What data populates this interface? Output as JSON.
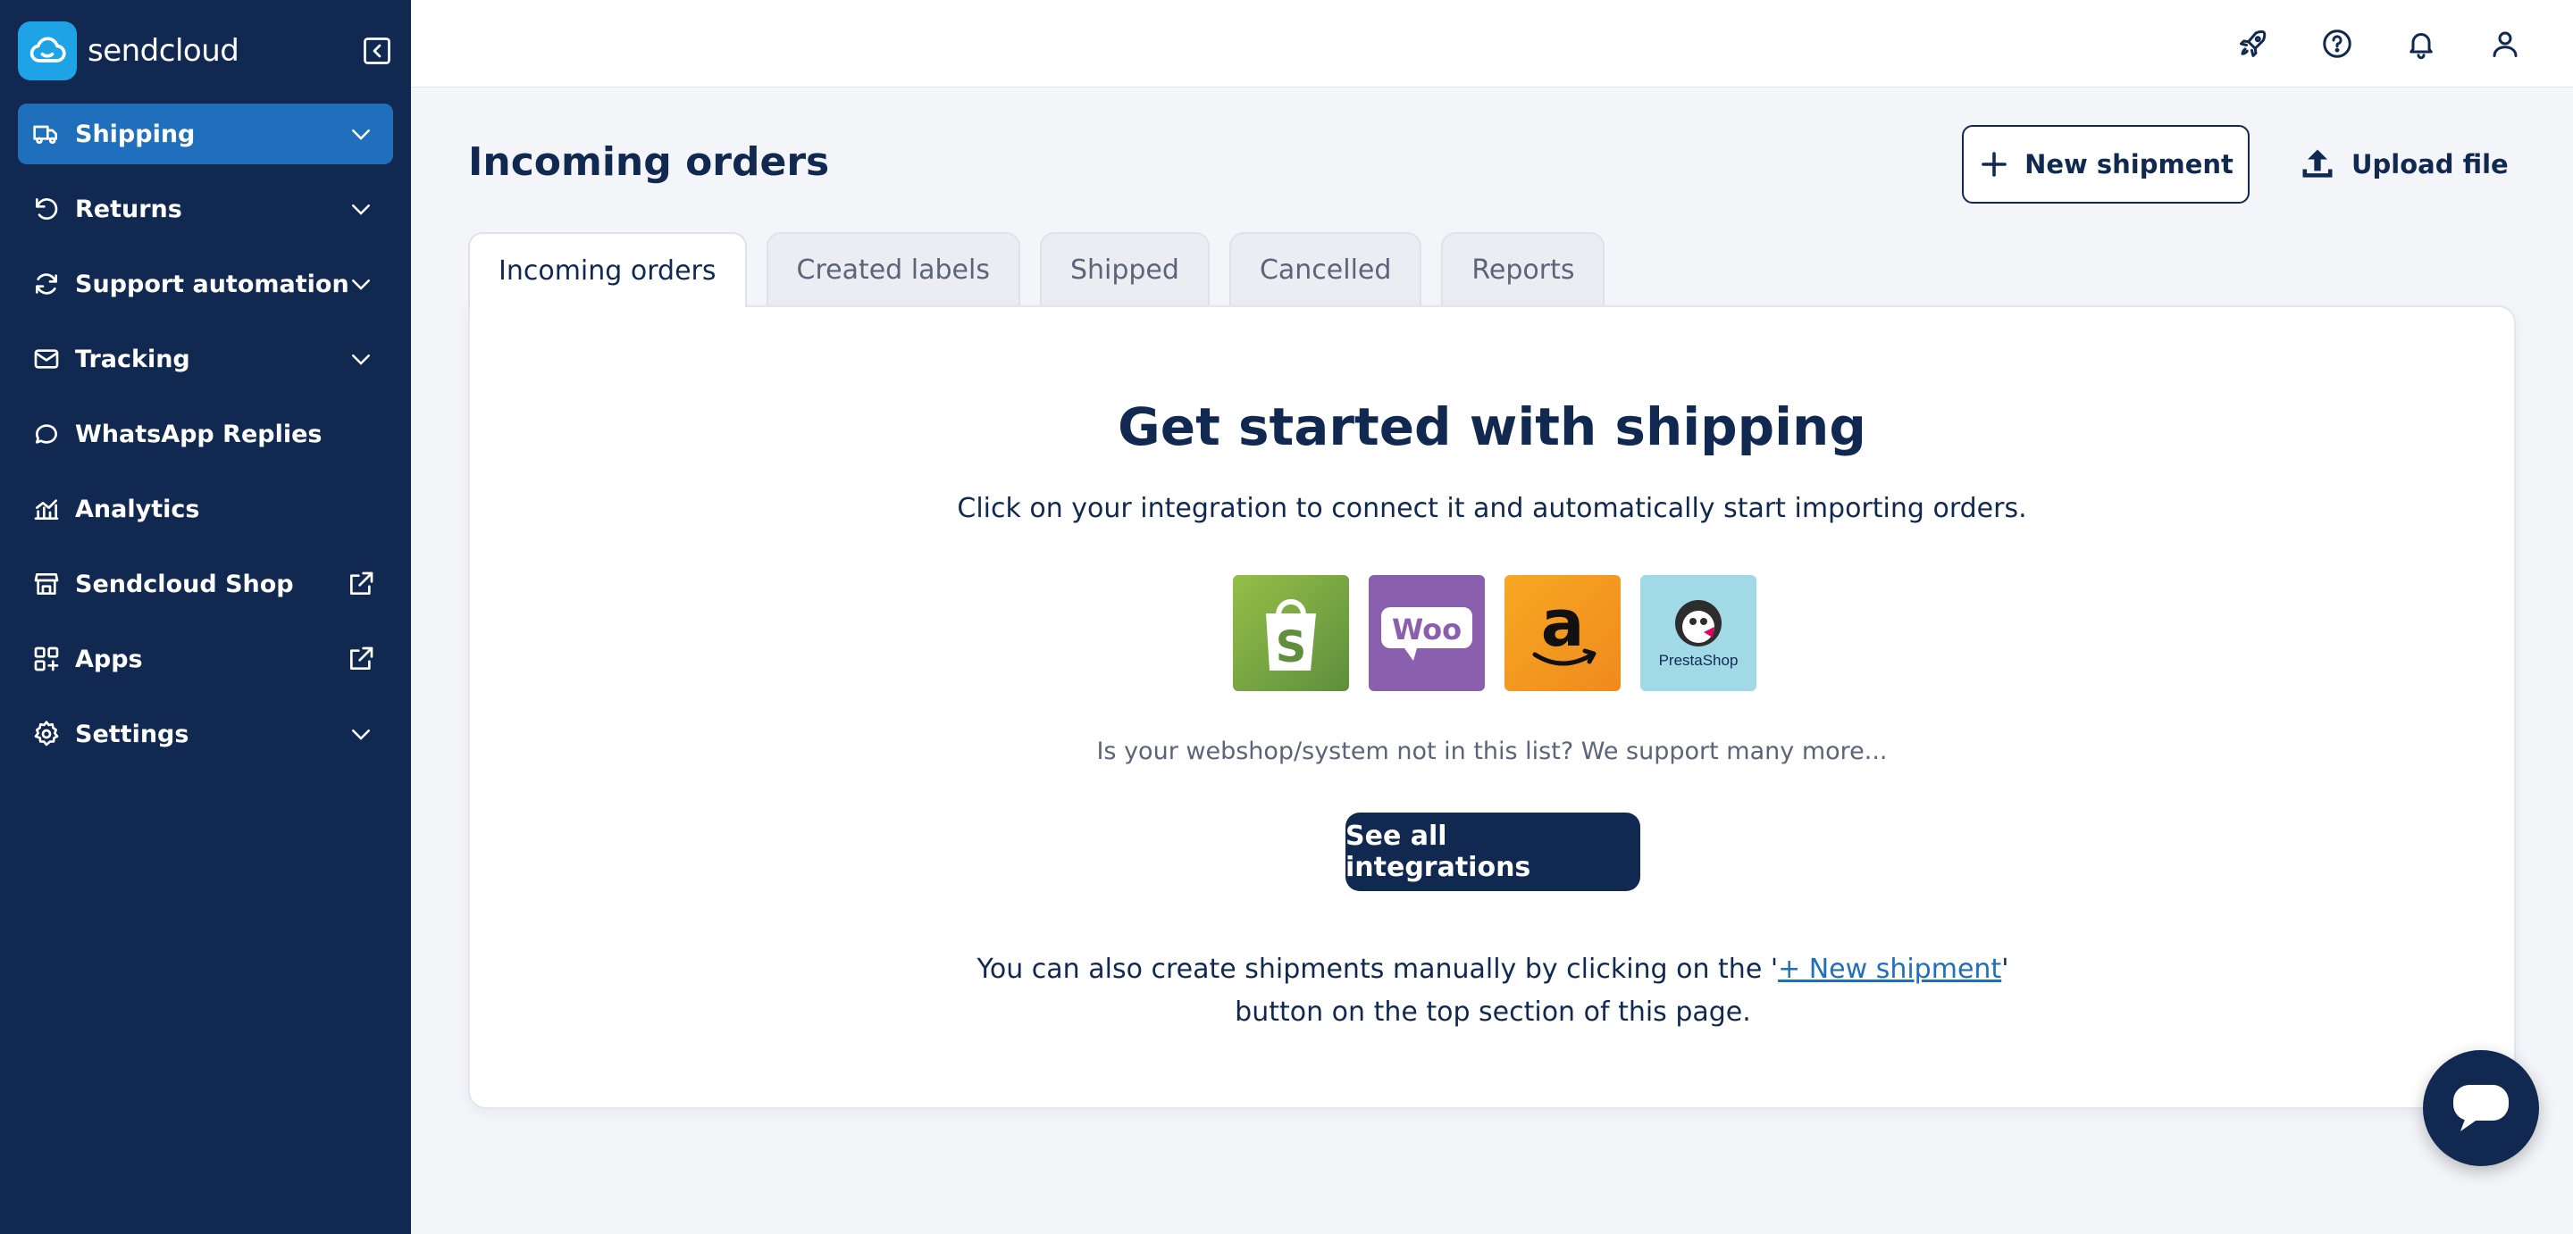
{
  "brand": {
    "name": "sendcloud",
    "color": "#1fa3e7"
  },
  "colors": {
    "navy": "#112951",
    "active": "#1f6fbd",
    "link": "#1f6fbd"
  },
  "sidebar": {
    "items": [
      {
        "label": "Shipping",
        "icon": "truck-icon",
        "trail": "chevron-down-icon",
        "active": true
      },
      {
        "label": "Returns",
        "icon": "return-icon",
        "trail": "chevron-down-icon"
      },
      {
        "label": "Support automation",
        "icon": "refresh-icon",
        "trail": "chevron-down-icon"
      },
      {
        "label": "Tracking",
        "icon": "mail-icon",
        "trail": "chevron-down-icon"
      },
      {
        "label": "WhatsApp Replies",
        "icon": "chat-bubble-icon",
        "trail": ""
      },
      {
        "label": "Analytics",
        "icon": "analytics-icon",
        "trail": ""
      },
      {
        "label": "Sendcloud Shop",
        "icon": "store-icon",
        "trail": "external-link-icon"
      },
      {
        "label": "Apps",
        "icon": "apps-icon",
        "trail": "external-link-icon"
      },
      {
        "label": "Settings",
        "icon": "gear-icon",
        "trail": "chevron-down-icon"
      }
    ]
  },
  "topbar": {
    "icons": [
      "rocket-icon",
      "help-icon",
      "bell-icon",
      "user-icon"
    ]
  },
  "page": {
    "title": "Incoming orders",
    "new_shipment_label": "New shipment",
    "upload_label": "Upload file"
  },
  "tabs": [
    {
      "label": "Incoming orders",
      "active": true
    },
    {
      "label": "Created labels"
    },
    {
      "label": "Shipped"
    },
    {
      "label": "Cancelled"
    },
    {
      "label": "Reports"
    }
  ],
  "card": {
    "heading": "Get started with shipping",
    "subtitle": "Click on your integration to connect it and automatically start importing orders.",
    "integrations": [
      {
        "name": "Shopify",
        "icon": "shopify-icon"
      },
      {
        "name": "WooCommerce",
        "icon": "woocommerce-icon",
        "text": "Woo"
      },
      {
        "name": "Amazon",
        "icon": "amazon-icon",
        "text": "a"
      },
      {
        "name": "PrestaShop",
        "icon": "prestashop-icon",
        "text": "PrestaShop"
      }
    ],
    "note": "Is your webshop/system not in this list? We support many more...",
    "button_label": "See all integrations",
    "footer_before": "You can also create shipments manually by clicking on the '",
    "footer_link": "+ New shipment",
    "footer_after": "' button on the top section of this page."
  }
}
